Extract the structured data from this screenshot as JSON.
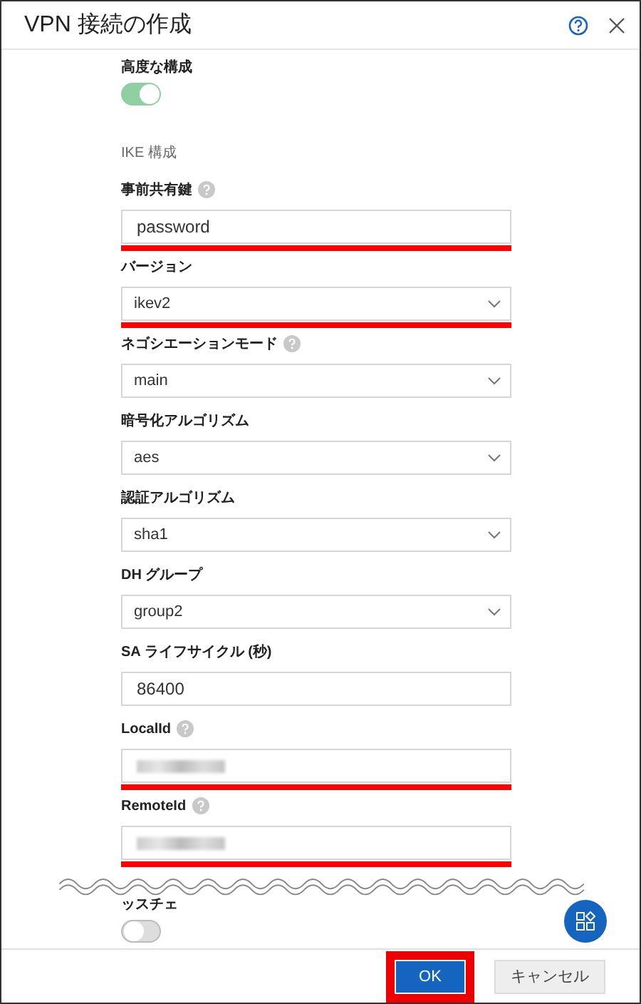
{
  "dialog": {
    "title": "VPN 接続の作成"
  },
  "advanced": {
    "label": "高度な構成",
    "on": true
  },
  "section_title": "IKE 構成",
  "fields": [
    {
      "kind": "text",
      "label": "事前共有鍵",
      "help": true,
      "value": "password",
      "highlighted": true
    },
    {
      "kind": "select",
      "label": "バージョン",
      "help": false,
      "value": "ikev2",
      "highlighted": true
    },
    {
      "kind": "select",
      "label": "ネゴシエーションモード",
      "help": true,
      "value": "main",
      "highlighted": false
    },
    {
      "kind": "select",
      "label": "暗号化アルゴリズム",
      "help": false,
      "value": "aes",
      "highlighted": false
    },
    {
      "kind": "select",
      "label": "認証アルゴリズム",
      "help": false,
      "value": "sha1",
      "highlighted": false
    },
    {
      "kind": "select",
      "label": "DH グループ",
      "help": false,
      "value": "group2",
      "highlighted": false
    },
    {
      "kind": "text",
      "label": "SA ライフサイクル (秒)",
      "help": false,
      "value": "86400",
      "highlighted": false
    },
    {
      "kind": "redacted",
      "label": "LocalId",
      "help": true,
      "highlighted": true
    },
    {
      "kind": "redacted",
      "label": "RemoteId",
      "help": true,
      "highlighted": true
    }
  ],
  "cut_setting": {
    "label": "ッスチェ",
    "on": false
  },
  "buttons": [
    {
      "label": "OK",
      "kind": "primary",
      "highlighted": true
    },
    {
      "label": "キャンセル",
      "kind": "secondary",
      "highlighted": false
    }
  ]
}
